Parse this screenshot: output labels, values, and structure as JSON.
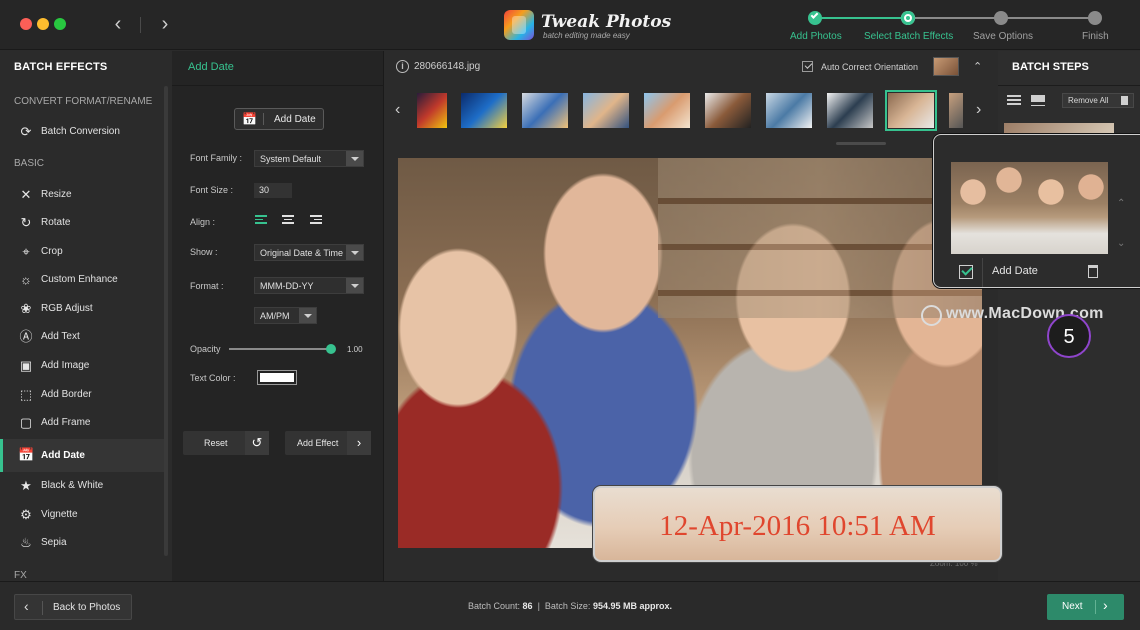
{
  "app": {
    "logo_title": "Tweak Photos",
    "logo_subtitle": "batch editing made easy",
    "colors": {
      "accent": "#37c28f",
      "date_text": "#e0462e",
      "step_badge": "#8f45cc"
    }
  },
  "steps": [
    {
      "label": "Add Photos",
      "state": "done"
    },
    {
      "label": "Select Batch Effects",
      "state": "current"
    },
    {
      "label": "Save Options",
      "state": "todo"
    },
    {
      "label": "Finish",
      "state": "todo"
    }
  ],
  "sidebar": {
    "title": "BATCH EFFECTS",
    "section_convert": "CONVERT FORMAT/RENAME",
    "section_basic": "BASIC",
    "section_fx": "FX",
    "items": [
      {
        "label": "Batch Conversion",
        "icon": "conversion-icon"
      },
      {
        "label": "Resize",
        "icon": "resize-icon"
      },
      {
        "label": "Rotate",
        "icon": "rotate-icon"
      },
      {
        "label": "Crop",
        "icon": "crop-icon"
      },
      {
        "label": "Custom Enhance",
        "icon": "enhance-icon"
      },
      {
        "label": "RGB Adjust",
        "icon": "rgb-icon"
      },
      {
        "label": "Add Text",
        "icon": "text-icon"
      },
      {
        "label": "Add Image",
        "icon": "image-icon"
      },
      {
        "label": "Add Border",
        "icon": "border-icon"
      },
      {
        "label": "Add Frame",
        "icon": "frame-icon"
      },
      {
        "label": "Add Date",
        "icon": "calendar-icon"
      },
      {
        "label": "Black & White",
        "icon": "bw-icon"
      },
      {
        "label": "Vignette",
        "icon": "vignette-icon"
      },
      {
        "label": "Sepia",
        "icon": "sepia-icon"
      }
    ]
  },
  "settings": {
    "title": "Add Date",
    "add_date_button": "Add Date",
    "font_family_label": "Font Family :",
    "font_family_value": "System Default",
    "font_size_label": "Font Size :",
    "font_size_value": "30",
    "align_label": "Align :",
    "show_label": "Show :",
    "show_value": "Original Date & Time",
    "format_label": "Format :",
    "format_value": "MMM-DD-YY",
    "ampm_value": "AM/PM",
    "opacity_label": "Opacity",
    "opacity_value": "1.00",
    "opacity_fraction": 1.0,
    "text_color_label": "Text Color :",
    "reset_button": "Reset",
    "add_effect_button": "Add Effect"
  },
  "main": {
    "file_name": "280666148.jpg",
    "auto_correct_label": "Auto Correct Orientation",
    "zoom_label": "Zoom: 100 %",
    "date_stamp": "12-Apr-2016 10:51 AM"
  },
  "right": {
    "title": "BATCH STEPS",
    "remove_all": "Remove All",
    "popup_label": "Add Date",
    "watermark": "www.MacDown.com",
    "step_number": "5"
  },
  "footer": {
    "back_button": "Back to Photos",
    "batch_count_label": "Batch Count:",
    "batch_count_value": "86",
    "batch_size_label": "Batch Size:",
    "batch_size_value": "954.95 MB approx.",
    "next_button": "Next"
  }
}
